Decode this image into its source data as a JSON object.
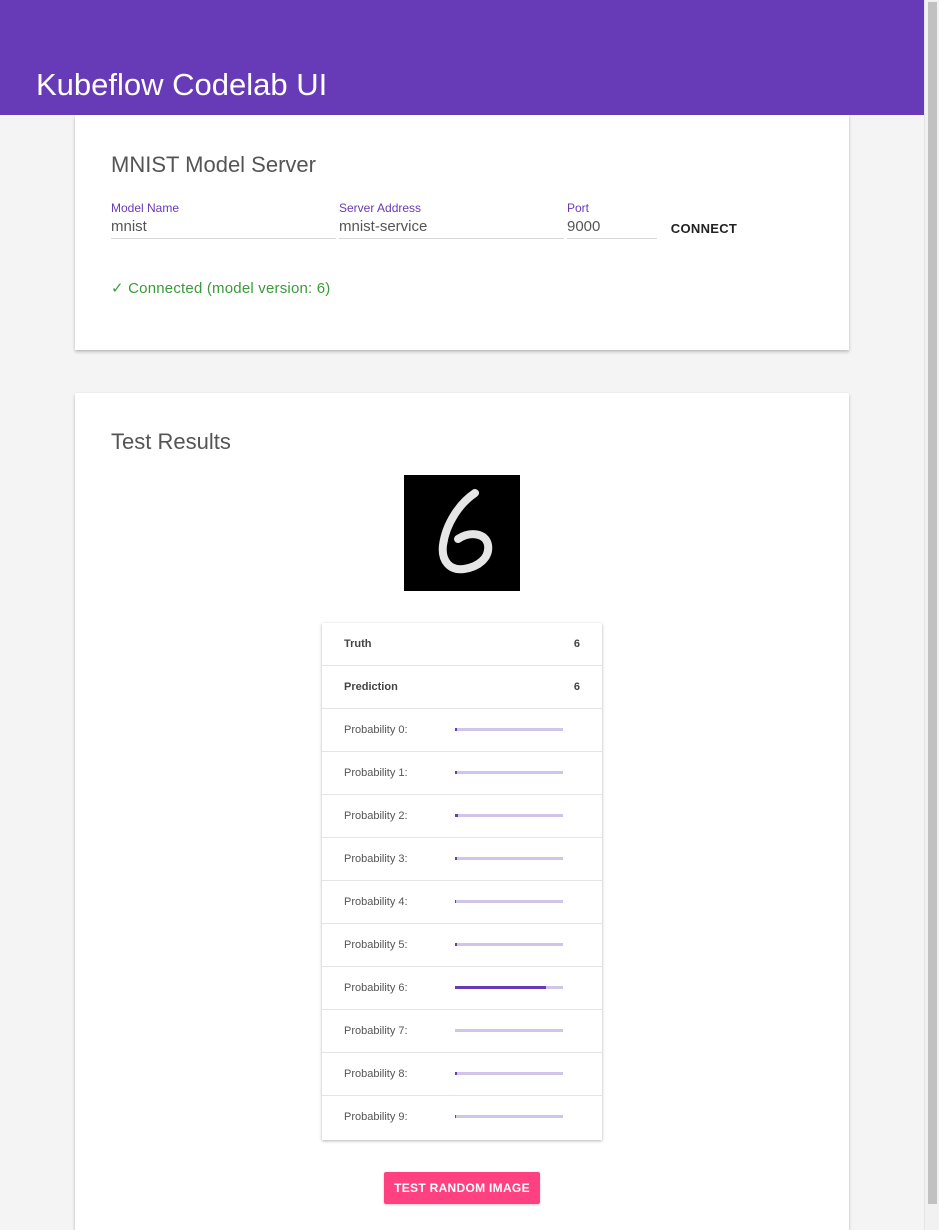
{
  "header": {
    "title": "Kubeflow Codelab UI",
    "color": "#673ab7"
  },
  "server_card": {
    "title": "MNIST Model Server",
    "fields": {
      "model_name": {
        "label": "Model Name",
        "value": "mnist"
      },
      "server_address": {
        "label": "Server Address",
        "value": "mnist-service"
      },
      "port": {
        "label": "Port",
        "value": "9000"
      }
    },
    "connect_label": "CONNECT",
    "status": "✓ Connected (model version: 6)",
    "status_color": "#3a9a3a"
  },
  "results_card": {
    "title": "Test Results",
    "image": {
      "description_icon": "mnist-digit-image"
    },
    "truth": {
      "label": "Truth",
      "value": "6"
    },
    "prediction": {
      "label": "Prediction",
      "value": "6"
    },
    "probabilities": [
      {
        "label": "Probability 0:",
        "value": 0.02
      },
      {
        "label": "Probability 1:",
        "value": 0.02
      },
      {
        "label": "Probability 2:",
        "value": 0.03
      },
      {
        "label": "Probability 3:",
        "value": 0.02
      },
      {
        "label": "Probability 4:",
        "value": 0.01
      },
      {
        "label": "Probability 5:",
        "value": 0.02
      },
      {
        "label": "Probability 6:",
        "value": 0.84
      },
      {
        "label": "Probability 7:",
        "value": 0.0
      },
      {
        "label": "Probability 8:",
        "value": 0.02
      },
      {
        "label": "Probability 9:",
        "value": 0.01
      }
    ],
    "bar_track_color": "#d1c4e9",
    "bar_fill_color": "#673ab7",
    "test_button_label": "TEST RANDOM IMAGE",
    "test_button_color": "#ff4081"
  }
}
